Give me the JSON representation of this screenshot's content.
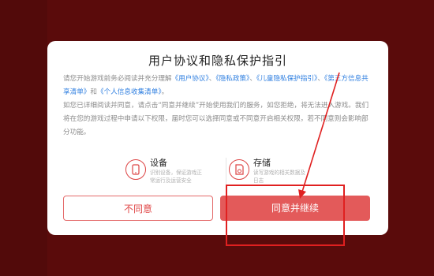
{
  "dialog": {
    "title": "用户协议和隐私保护指引",
    "p1": {
      "lead": "请您开始游戏前务必阅读并充分理解",
      "links": [
        "《用户协议》",
        "《隐私政策》",
        "《儿童隐私保护指引》",
        "《第三方信息共享清单》",
        "《个人信息收集清单》"
      ],
      "sep1": "、",
      "sep2": "、",
      "sep3": "、",
      "and": "和",
      "end": "。"
    },
    "p2": "如您已详细阅读并同意，请点击“同意并继续”开始使用我们的服务，如您拒绝，将无法进入游戏。我们将在您的游戏过程中申请以下权限，届时您可以选择同意或不同意开启相关权限，若不同意则会影响部分功能。",
    "permissions": [
      {
        "icon": "phone-icon",
        "title": "设备",
        "desc": "识别设备，保证游戏正常运行及运营安全"
      },
      {
        "icon": "storage-icon",
        "title": "存储",
        "desc": "读写游戏的相关数据及日志"
      }
    ],
    "decline_label": "不同意",
    "agree_label": "同意并继续"
  },
  "colors": {
    "background": "#5a0b0b",
    "accent": "#e35a5a",
    "link": "#2f7fe0",
    "annotation": "#e02020"
  }
}
